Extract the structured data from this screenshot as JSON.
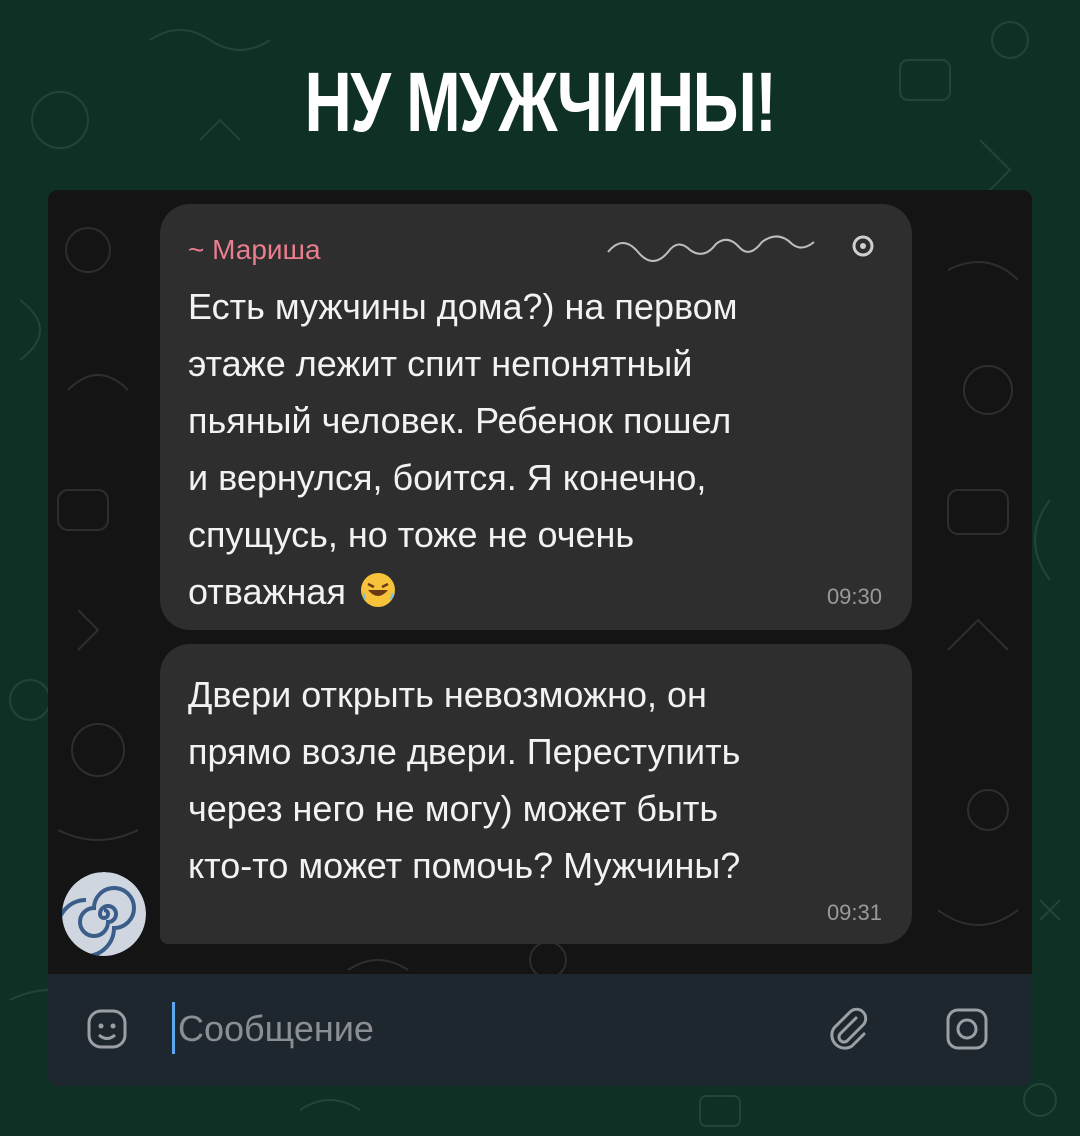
{
  "headline": "НУ МУЖЧИНЫ!",
  "chat": {
    "messages": [
      {
        "sender": "~ Мариша",
        "text": "Есть мужчины дома?) на первом\nэтаже лежит спит непонятный\nпьяный человек. Ребенок пошел\nи вернулся, боится. Я конечно,\nспущусь, но тоже не очень\nотважная",
        "emoji": "rolling-on-floor-laughing-icon",
        "time": "09:30"
      },
      {
        "text": "Двери открыть невозможно, он\nпрямо возле двери. Переступить\nчерез него не могу) может быть\nкто-то может помочь? Мужчины?",
        "time": "09:31"
      }
    ],
    "sender_color": "#e97e8c"
  },
  "composer": {
    "placeholder": "Сообщение",
    "icons": [
      "sticker-icon",
      "paperclip-icon",
      "camera-icon"
    ]
  },
  "colors": {
    "background": "#0f3125",
    "bubble": "#2e2e2e",
    "composer": "#1f272e"
  }
}
